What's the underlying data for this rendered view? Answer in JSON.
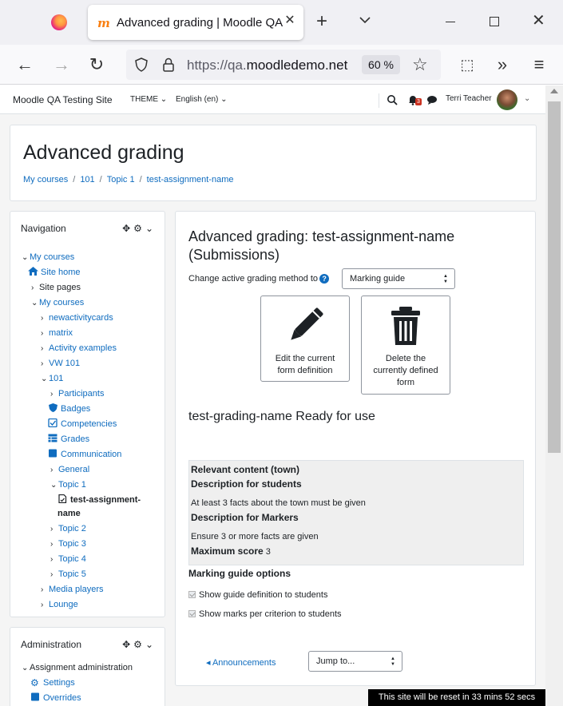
{
  "browser": {
    "tab_title": "Advanced grading | Moodle QA Testing Site",
    "url_prefix": "https://qa.",
    "url_domain": "moodledemo.net",
    "zoom": "60 %"
  },
  "site": {
    "name": "Moodle QA Testing Site",
    "theme_menu": "THEME",
    "lang_menu": "English (en)",
    "notification_count": "3",
    "user_name": "Terri Teacher"
  },
  "header": {
    "title": "Advanced grading",
    "breadcrumb": [
      "My courses",
      "101",
      "Topic 1",
      "test-assignment-name"
    ]
  },
  "navigation": {
    "title": "Navigation",
    "items": [
      {
        "label": "My courses"
      },
      {
        "label": "Site home"
      },
      {
        "label": "Site pages"
      },
      {
        "label": "My courses"
      },
      {
        "label": "newactivitycards"
      },
      {
        "label": "matrix"
      },
      {
        "label": "Activity examples"
      },
      {
        "label": "VW 101"
      },
      {
        "label": "101"
      },
      {
        "label": "Participants"
      },
      {
        "label": "Badges"
      },
      {
        "label": "Competencies"
      },
      {
        "label": "Grades"
      },
      {
        "label": "Communication"
      },
      {
        "label": "General"
      },
      {
        "label": "Topic 1"
      },
      {
        "label": "test-assignment-"
      },
      {
        "label": "name"
      },
      {
        "label": "Topic 2"
      },
      {
        "label": "Topic 3"
      },
      {
        "label": "Topic 4"
      },
      {
        "label": "Topic 5"
      },
      {
        "label": "Media players"
      },
      {
        "label": "Lounge"
      }
    ]
  },
  "administration": {
    "title": "Administration",
    "items": [
      {
        "label": "Assignment administration"
      },
      {
        "label": "Settings"
      },
      {
        "label": "Overrides"
      }
    ]
  },
  "main": {
    "heading": "Advanced grading: test-assignment-name (Submissions)",
    "method_label": "Change active grading method to",
    "method_selected": "Marking guide",
    "edit_button": "Edit the current form definition",
    "delete_button": "Delete the currently defined form",
    "status": "test-grading-name Ready for use",
    "guide": {
      "criterion": "Relevant content (town)",
      "desc_students_label": "Description for students",
      "desc_students": "At least 3 facts about the town must be given",
      "desc_markers_label": "Description for Markers",
      "desc_markers": "Ensure 3 or more facts are given",
      "max_score_label": "Maximum score",
      "max_score": "3"
    },
    "options_title": "Marking guide options",
    "option1": "Show guide definition to students",
    "option2": "Show marks per criterion to students",
    "announcements": "◂ Announcements",
    "jump_to": "Jump to..."
  },
  "reset_notice": "This site will be reset in 33 mins 52 secs"
}
